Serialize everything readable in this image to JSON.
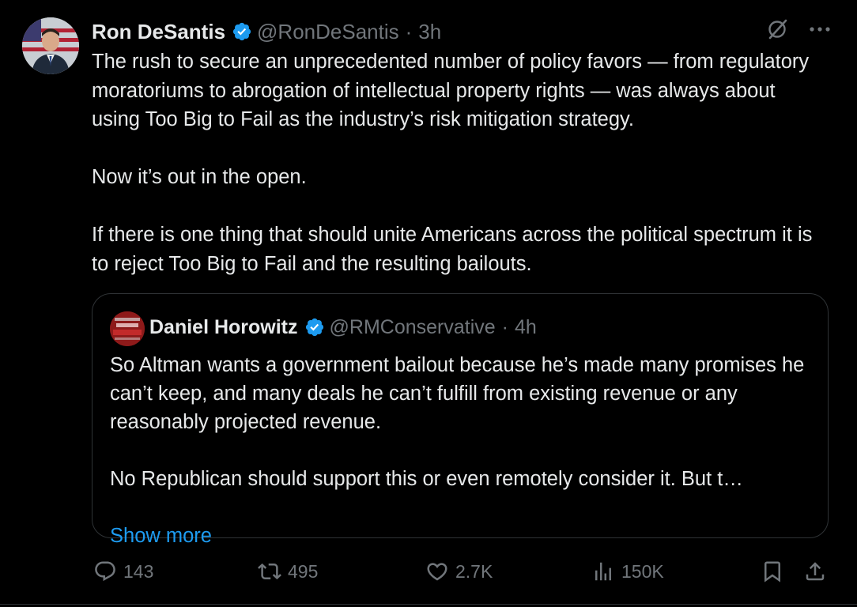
{
  "tweet": {
    "author_name": "Ron DeSantis",
    "handle": "@RonDeSantis",
    "separator": "·",
    "time": "3h",
    "paragraphs": [
      "The rush to secure an unprecedented number of policy favors — from regulatory moratoriums to abrogation of intellectual property rights — was always about using Too Big to Fail as the industry’s risk mitigation strategy.",
      "Now it’s out in the open.",
      "If there is one thing that should unite Americans across the political spectrum it is to reject Too Big to Fail and the resulting bailouts."
    ]
  },
  "quote": {
    "author_name": "Daniel Horowitz",
    "handle": "@RMConservative",
    "separator": "·",
    "time": "4h",
    "paragraphs": [
      "So Altman wants a government bailout because he’s made many promises he can’t keep, and many deals he can’t fulfill from existing revenue or any reasonably projected revenue.",
      "No Republican should support this or even remotely consider it.  But t…"
    ],
    "show_more": "Show more"
  },
  "actions": {
    "replies": "143",
    "reposts": "495",
    "likes": "2.7K",
    "views": "150K"
  },
  "colors": {
    "background": "#000000",
    "text": "#e7e9ea",
    "secondary": "#71767b",
    "accent": "#1d9bf0",
    "border": "#2f3336"
  },
  "icons": [
    "verified-badge-icon",
    "grok-icon",
    "more-icon",
    "reply-icon",
    "repost-icon",
    "like-icon",
    "views-icon",
    "bookmark-icon",
    "share-icon"
  ]
}
